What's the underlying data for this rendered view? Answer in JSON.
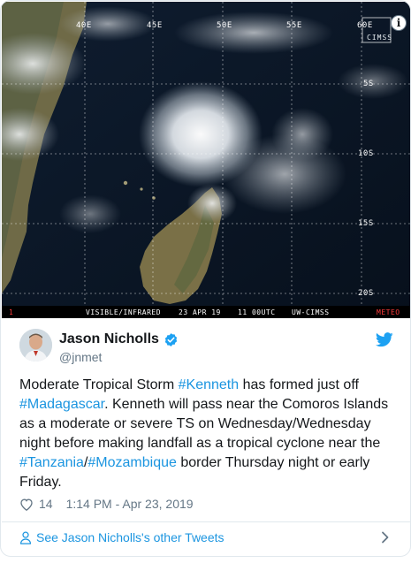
{
  "media": {
    "longitude_labels": [
      "40E",
      "45E",
      "50E",
      "55E",
      "60E"
    ],
    "latitude_labels": [
      "5S",
      "10S",
      "15S",
      "20S"
    ],
    "watermark": "CIMSS",
    "strip": {
      "marker": "1",
      "band": "VISIBLE/INFRARED",
      "date": "23 APR 19",
      "time": "11 00UTC",
      "source": "UW-CIMSS",
      "badge": "METEO"
    },
    "info_icon": "i"
  },
  "tweet": {
    "author_name": "Jason Nicholls",
    "handle": "@jnmet",
    "verified_icon": "verified-badge-icon",
    "platform_icon": "twitter-bird-icon",
    "text_parts": {
      "p1": "Moderate Tropical Storm ",
      "tag_kenneth": "#Kenneth",
      "p2": " has formed just off ",
      "tag_madagascar": "#Madagascar",
      "p3": ". Kenneth will pass near the Comoros Islands as a moderate or severe TS on Wednesday/Wednesday night before making landfall as a tropical cyclone near the ",
      "tag_tanzania": "#Tanzania",
      "p4": "/",
      "tag_mozambique": "#Mozambique",
      "p5": " border Thursday night or early Friday."
    },
    "likes": "14",
    "timestamp": "1:14 PM - Apr 23, 2019"
  },
  "footer": {
    "see_more_label": "See Jason Nicholls's other Tweets"
  },
  "colors": {
    "link": "#1b95e0",
    "text": "#14171a",
    "muted": "#657786",
    "border": "#e1e8ed"
  }
}
